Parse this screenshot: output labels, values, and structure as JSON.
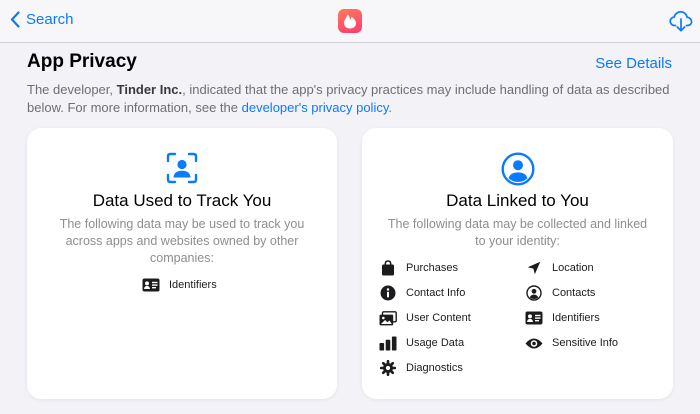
{
  "nav": {
    "back_label": "Search",
    "icons": {
      "back": "chevron-left-icon",
      "app": "flame-icon",
      "download": "cloud-download-icon"
    }
  },
  "privacy": {
    "title": "App Privacy",
    "see_details": "See Details",
    "description_prefix": "The developer, ",
    "developer": "Tinder Inc.",
    "description_middle": ", indicated that the app's privacy practices may include handling of data as described below. For more information, see the ",
    "policy_link": "developer's privacy policy",
    "description_suffix": "."
  },
  "track": {
    "icon": "person-viewfinder-icon",
    "title": "Data Used to Track You",
    "subtitle": "The following data may be used to track you across apps and websites owned by other companies:",
    "items": [
      {
        "label": "Identifiers",
        "icon": "id-card-icon"
      }
    ]
  },
  "linked": {
    "icon": "person-circle-icon",
    "title": "Data Linked to You",
    "subtitle": "The following data may be collected and linked to your identity:",
    "items": [
      {
        "label": "Purchases",
        "icon": "shopping-bag-icon"
      },
      {
        "label": "Location",
        "icon": "location-arrow-icon"
      },
      {
        "label": "Contact Info",
        "icon": "info-circle-icon"
      },
      {
        "label": "Contacts",
        "icon": "contact-circle-icon"
      },
      {
        "label": "User Content",
        "icon": "photos-icon"
      },
      {
        "label": "Identifiers",
        "icon": "id-card-icon"
      },
      {
        "label": "Usage Data",
        "icon": "bar-chart-icon"
      },
      {
        "label": "Sensitive Info",
        "icon": "eye-icon"
      },
      {
        "label": "Diagnostics",
        "icon": "gear-icon"
      }
    ]
  },
  "colors": {
    "accent": "#0a7aff",
    "background": "#f2f2f7",
    "card": "#ffffff",
    "secondary_text": "#8e8e93",
    "app_icon": "#fd5068"
  }
}
